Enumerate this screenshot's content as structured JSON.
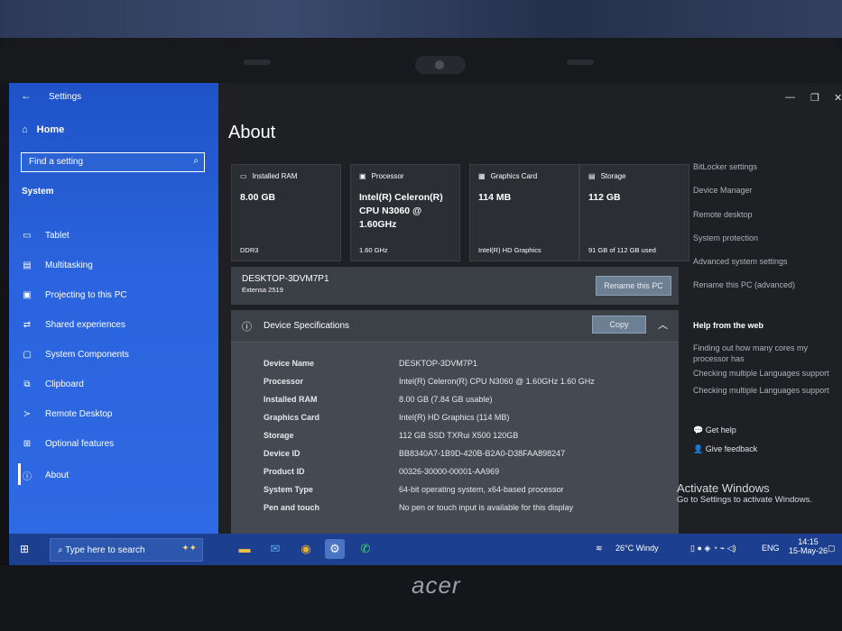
{
  "sidebar": {
    "back": "←",
    "title": "Settings",
    "home": "Home",
    "search_placeholder": "Find a setting",
    "section": "System",
    "items": [
      {
        "label": "Tablet",
        "icon": "tablet-icon"
      },
      {
        "label": "Multitasking",
        "icon": "multitasking-icon"
      },
      {
        "label": "Projecting to this PC",
        "icon": "projector-icon"
      },
      {
        "label": "Shared experiences",
        "icon": "shared-icon"
      },
      {
        "label": "System Components",
        "icon": "components-icon"
      },
      {
        "label": "Clipboard",
        "icon": "clipboard-icon"
      },
      {
        "label": "Remote Desktop",
        "icon": "remote-icon"
      },
      {
        "label": "Optional features",
        "icon": "features-icon"
      },
      {
        "label": "About",
        "icon": "info-icon"
      }
    ]
  },
  "main": {
    "title": "About",
    "cards": [
      {
        "header": "Installed RAM",
        "value": "8.00 GB",
        "sub": "DDR3"
      },
      {
        "header": "Processor",
        "value": "Intel(R) Celeron(R) CPU N3060 @ 1.60GHz",
        "sub": "1.60 GHz"
      },
      {
        "header": "Graphics Card",
        "value": "114 MB",
        "sub": "Intel(R) HD Graphics"
      },
      {
        "header": "Storage",
        "value": "112 GB",
        "sub": "91 GB of 112 GB used"
      }
    ],
    "pc_name": "DESKTOP-3DVM7P1",
    "pc_model": "Extensa 2519",
    "rename_btn": "Rename this PC",
    "spec_title": "Device Specifications",
    "copy_btn": "Copy",
    "specs": [
      {
        "k": "Device Name",
        "v": "DESKTOP-3DVM7P1"
      },
      {
        "k": "Processor",
        "v": "Intel(R) Celeron(R) CPU N3060 @ 1.60GHz 1.60 GHz"
      },
      {
        "k": "Installed RAM",
        "v": "8.00 GB (7.84 GB usable)"
      },
      {
        "k": "Graphics Card",
        "v": "Intel(R) HD Graphics (114 MB)"
      },
      {
        "k": "Storage",
        "v": "112 GB SSD TXRui X500 120GB"
      },
      {
        "k": "Device ID",
        "v": "BB8340A7-1B9D-420B-B2A0-D38FAA898247"
      },
      {
        "k": "Product ID",
        "v": "00326-30000-00001-AA969"
      },
      {
        "k": "System Type",
        "v": "64-bit operating system, x64-based processor"
      },
      {
        "k": "Pen and touch",
        "v": "No pen or touch input is available for this display"
      }
    ]
  },
  "related": {
    "links": [
      "BitLocker settings",
      "Device Manager",
      "Remote desktop",
      "System protection",
      "Advanced system settings",
      "Rename this PC (advanced)"
    ],
    "help_title": "Help from the web",
    "help_links": [
      "Finding out how many cores my processor has",
      "Checking multiple Languages support",
      "Checking multiple Languages support"
    ],
    "get_help": "Get help",
    "give_feedback": "Give feedback"
  },
  "watermark": {
    "line1": "Activate Windows",
    "line2": "Go to Settings to activate Windows."
  },
  "taskbar": {
    "search": "Type here to search",
    "weather": "26°C Windy",
    "lang": "ENG",
    "time": "14:15",
    "date": "15-May-26"
  },
  "brand": "acer"
}
